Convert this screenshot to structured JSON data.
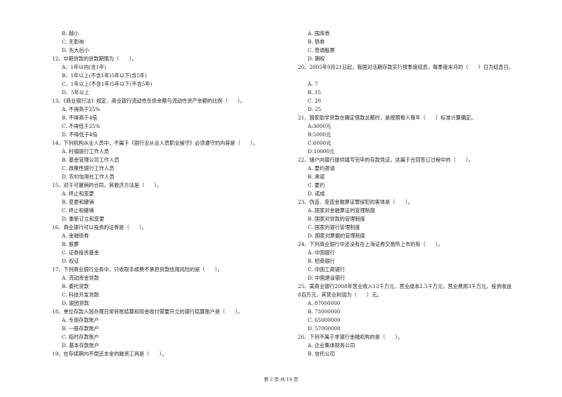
{
  "page": {
    "left_column": [
      {
        "type": "opt",
        "text": "B. 越小"
      },
      {
        "type": "opt",
        "text": "C. 无影响"
      },
      {
        "type": "opt",
        "text": "D. 先大后小"
      },
      {
        "type": "q",
        "text": "12、中期贷款的贷款期限为（　　）。"
      },
      {
        "type": "opt",
        "text": "A、1年以内(含1年)"
      },
      {
        "type": "opt",
        "text": "B、1年以上(不含1年)5年以下(含5年)"
      },
      {
        "type": "opt",
        "text": "C、1年以上(不含1年)5年以下(不含5年)"
      },
      {
        "type": "opt",
        "text": "D、5年以上"
      },
      {
        "type": "q",
        "text": "13、《商业银行法》规定，商业银行流动性负债余额与流动性资产余额的比例（　　）。"
      },
      {
        "type": "opt",
        "text": "A. 不得高于25%"
      },
      {
        "type": "opt",
        "text": "B. 不得高于4倍"
      },
      {
        "type": "opt",
        "text": "C. 不得低于25%"
      },
      {
        "type": "opt",
        "text": "D. 不得低于4倍"
      },
      {
        "type": "q",
        "text": "14、下列机构从业人员中，不属于《银行业从业人员职业操守》必须遵守的内容是（　　）。"
      },
      {
        "type": "opt",
        "text": "A. 村镇银行工作人员"
      },
      {
        "type": "opt",
        "text": "B. 基金管理公司工作人员"
      },
      {
        "type": "opt",
        "text": "C. 政策性银行工作人员"
      },
      {
        "type": "opt",
        "text": "D. 农村信用社工作人员"
      },
      {
        "type": "q",
        "text": "15、对于可撤销的合同，其救济方法是（　　）。"
      },
      {
        "type": "opt",
        "text": "A. 终止和变更"
      },
      {
        "type": "opt",
        "text": "B. 变更和撤销"
      },
      {
        "type": "opt",
        "text": "C. 终止和撤销"
      },
      {
        "type": "opt",
        "text": "D. 重新订立和变更"
      },
      {
        "type": "q",
        "text": "16、商业银行可以投资的证券是（　　）。"
      },
      {
        "type": "opt",
        "text": "A. 金融债券"
      },
      {
        "type": "opt",
        "text": "B. 股票"
      },
      {
        "type": "opt",
        "text": "C. 证券投资基金"
      },
      {
        "type": "opt",
        "text": "D. 权证"
      },
      {
        "type": "q",
        "text": "17、下列商业银行业务中，只收取手续费不承担贷款信用风险的是（　　）。"
      },
      {
        "type": "opt",
        "text": "A. 流动资金贷款"
      },
      {
        "type": "opt",
        "text": "B. 委托贷款"
      },
      {
        "type": "opt",
        "text": "C. 科技开发贷款"
      },
      {
        "type": "opt",
        "text": "D. 银团贷款"
      },
      {
        "type": "q",
        "text": "18、单位存款人因办理日常转账结算和现金收付需要开立的银行结算账户是（　　）。"
      },
      {
        "type": "opt",
        "text": "A. 专用存款账户"
      },
      {
        "type": "opt",
        "text": "B. 一般存款账户"
      },
      {
        "type": "opt",
        "text": "C. 临时存款账户"
      },
      {
        "type": "opt",
        "text": "D. 基本存款账户"
      },
      {
        "type": "q",
        "text": "19、在存续期内不偿还本金的融资工具是（　　）。"
      }
    ],
    "right_column": [
      {
        "type": "opt",
        "text": "A. 国库券"
      },
      {
        "type": "opt",
        "text": "B. 债券"
      },
      {
        "type": "opt",
        "text": "C. 普通股票"
      },
      {
        "type": "opt",
        "text": "D. 期权"
      },
      {
        "type": "q",
        "text": "20、2005年9月21日起，我国对活期存款实行按季度结息，每季度末月的（　　）日为结息日。"
      },
      {
        "type": "gap",
        "text": ""
      },
      {
        "type": "opt",
        "text": "A. 7"
      },
      {
        "type": "opt",
        "text": "B. 15"
      },
      {
        "type": "opt",
        "text": "C. 20"
      },
      {
        "type": "opt",
        "text": "D. 25"
      },
      {
        "type": "q",
        "text": "21、国家助学贷款在确定借款总额时，是按照每人每年（　　）标准计算确定。"
      },
      {
        "type": "opt",
        "text": "A:3000元"
      },
      {
        "type": "opt",
        "text": "B:5000元"
      },
      {
        "type": "opt",
        "text": "C:6000元"
      },
      {
        "type": "opt",
        "text": "D:10000元"
      },
      {
        "type": "q",
        "text": "22、储户向银行提供填写完毕的存款凭证，这属于合同签订过程中的（　　）。"
      },
      {
        "type": "opt",
        "text": "A. 要约邀请"
      },
      {
        "type": "opt",
        "text": "B. 承诺"
      },
      {
        "type": "opt",
        "text": "C. 要约"
      },
      {
        "type": "opt",
        "text": "D. 诺成"
      },
      {
        "type": "q",
        "text": "23、伪造、变造金融票证罪侵犯的客体是（　　）。"
      },
      {
        "type": "opt",
        "text": "A. 国家对金融票证的管理制度"
      },
      {
        "type": "opt",
        "text": "B. 国家对贷款的管理制度"
      },
      {
        "type": "opt",
        "text": "C. 国家的银行管理制度"
      },
      {
        "type": "opt",
        "text": "D. 国家对票据的管理制度"
      },
      {
        "type": "q",
        "text": "24、下列商业银行中还没有在上海证券交易所上市的有（　　）。"
      },
      {
        "type": "opt",
        "text": "A. 中国银行"
      },
      {
        "type": "opt",
        "text": "B. 招商银行"
      },
      {
        "type": "opt",
        "text": "C. 中国工商银行"
      },
      {
        "type": "opt",
        "text": "D. 中国建设银行"
      },
      {
        "type": "q",
        "text": "25、某商业银行2008年营业收入12千万元，营业成本2.5千万元，营业费用3千万元，投资收益"
      },
      {
        "type": "q",
        "text": "8百万元，其营业利润为（　　）元。"
      },
      {
        "type": "opt",
        "text": "A. 87000000"
      },
      {
        "type": "opt",
        "text": "B. 73000000"
      },
      {
        "type": "opt",
        "text": "C. 65000000"
      },
      {
        "type": "opt",
        "text": "D. 57000000"
      },
      {
        "type": "q",
        "text": "26、下列不属于非银行金融机构的是（　　）。"
      },
      {
        "type": "opt",
        "text": "A. 企业集体财务公司"
      },
      {
        "type": "opt",
        "text": "B. 信托公司"
      }
    ],
    "footer": "第 2 页 共 14 页"
  }
}
